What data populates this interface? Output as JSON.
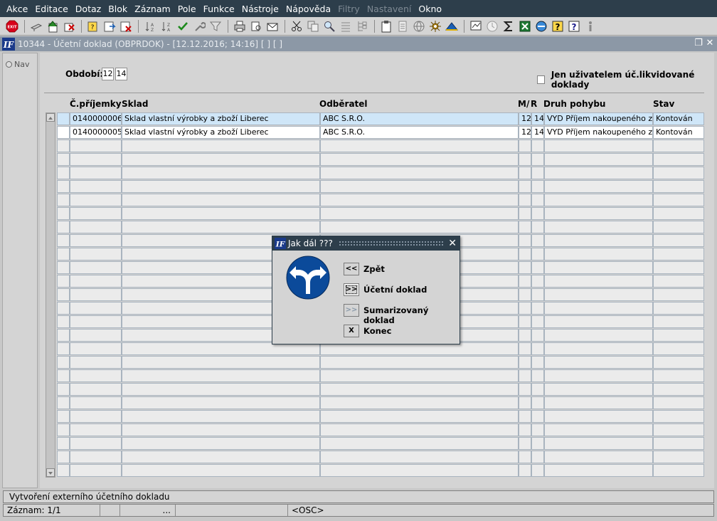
{
  "menu": [
    {
      "label": "Akce",
      "disabled": false
    },
    {
      "label": "Editace",
      "disabled": false
    },
    {
      "label": "Dotaz",
      "disabled": false
    },
    {
      "label": "Blok",
      "disabled": false
    },
    {
      "label": "Záznam",
      "disabled": false
    },
    {
      "label": "Pole",
      "disabled": false
    },
    {
      "label": "Funkce",
      "disabled": false
    },
    {
      "label": "Nástroje",
      "disabled": false
    },
    {
      "label": "Nápověda",
      "disabled": false
    },
    {
      "label": "Filtry",
      "disabled": true
    },
    {
      "label": "Nastavení",
      "disabled": true
    },
    {
      "label": "Okno",
      "disabled": false
    }
  ],
  "toolbar": {
    "exit_label": "EXIT"
  },
  "window": {
    "title": "10344 - Účetní doklad (OBPRDOK) - [12.12.2016; 14:16]  [ ]  [ ]"
  },
  "nav": {
    "label": "Nav"
  },
  "filter": {
    "period_label": "Období:",
    "period_month": "12",
    "period_year": "14",
    "checkbox_label": "Jen uživatelem úč.likvidované doklady",
    "checkbox_checked": false
  },
  "table": {
    "headers": {
      "cislo": "Č.příjemky",
      "sklad": "Sklad",
      "odberatel": "Odběratel",
      "m": "M/",
      "r": "R",
      "druh": "Druh pohybu",
      "stav": "Stav"
    },
    "rows": [
      {
        "cislo": "0140000006",
        "sklad": "Sklad vlastní výrobky a zboží Liberec",
        "odberatel": "ABC S.R.O.",
        "m": "12",
        "r": "14",
        "druh": "VYD Příjem nakoupeného zboží",
        "stav": "Kontován"
      },
      {
        "cislo": "0140000005",
        "sklad": "Sklad vlastní výrobky a zboží Liberec",
        "odberatel": "ABC S.R.O.",
        "m": "12",
        "r": "14",
        "druh": "VYD Příjem nakoupeného zboží",
        "stav": "Kontován"
      }
    ],
    "total_rows": 27
  },
  "dialog": {
    "title": "Jak dál ???",
    "options": [
      {
        "button": "<<",
        "label": "Zpět"
      },
      {
        "button": ">>",
        "label": "Účetní doklad"
      },
      {
        "button": ">>",
        "label": "Sumarizovaný doklad"
      },
      {
        "button": "X",
        "label": "Konec"
      }
    ]
  },
  "status": {
    "message": "Vytvoření externího účetního dokladu",
    "record": "Záznam: 1/1",
    "seg3": "...",
    "mode": "<OSC>"
  }
}
